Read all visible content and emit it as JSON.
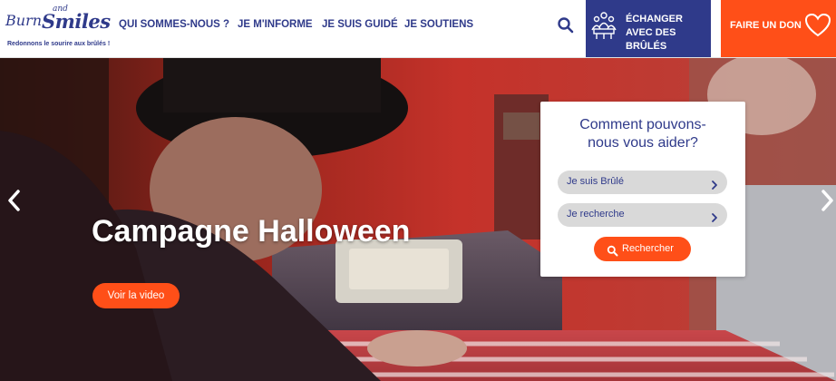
{
  "brand": {
    "logo_burn": "Burn",
    "logo_and": "and",
    "logo_smiles": "Smiles",
    "tagline": "Redonnons le sourire aux brûlés !"
  },
  "nav": {
    "items": [
      {
        "label": "QUI SOMMES-NOUS ?"
      },
      {
        "label": "JE M'INFORME"
      },
      {
        "label": "JE SUIS GUIDÉ"
      },
      {
        "label": "JE SOUTIENS"
      }
    ],
    "search_icon": "search-icon"
  },
  "cta": {
    "exchange_label": "ÉCHANGER AVEC DES BRÛLÉS",
    "exchange_icon": "community-icon",
    "donate_label": "FAIRE UN DON",
    "donate_icon": "heart-icon"
  },
  "hero": {
    "title": "Campagne Halloween",
    "video_button": "Voir la video",
    "prev_icon": "chevron-left-icon",
    "next_icon": "chevron-right-icon"
  },
  "help": {
    "title_line1": "Comment pouvons-",
    "title_line2": "nous vous aider?",
    "options": [
      {
        "label": "Je suis Brûlé"
      },
      {
        "label": "Je recherche"
      }
    ],
    "submit_label": "Rechercher"
  },
  "colors": {
    "brand_blue": "#2f3a8a",
    "accent_orange": "#ff4f18"
  }
}
